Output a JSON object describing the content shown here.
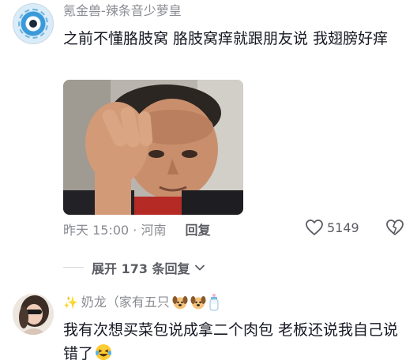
{
  "comment1": {
    "username": "氪金兽-辣条音少萝皇",
    "text": "之前不懂胳肢窝 胳肢窝痒就跟朋友说 我翅膀好痒",
    "timestamp": "昨天 15:00 · 河南",
    "reply_label": "回复",
    "like_count": "5149",
    "avatar_icon": "eye-badge-avatar",
    "image": "photo-man-rubbing-forehead"
  },
  "replies": {
    "expand_label": "展开 173 条回复"
  },
  "comment2": {
    "username_prefix": "✨",
    "username": "奶龙（家有五只",
    "text": "我有次想买菜包说成拿二个肉包  老板还说我自己说错了",
    "emoji_names": [
      "dog-emoji",
      "dog-emoji",
      "baby-bottle-emoji",
      "laughing-crying-emoji"
    ]
  },
  "colors": {
    "primary_text": "#161823",
    "secondary_text": "#8a8b91",
    "action_text": "#5b5c63"
  }
}
